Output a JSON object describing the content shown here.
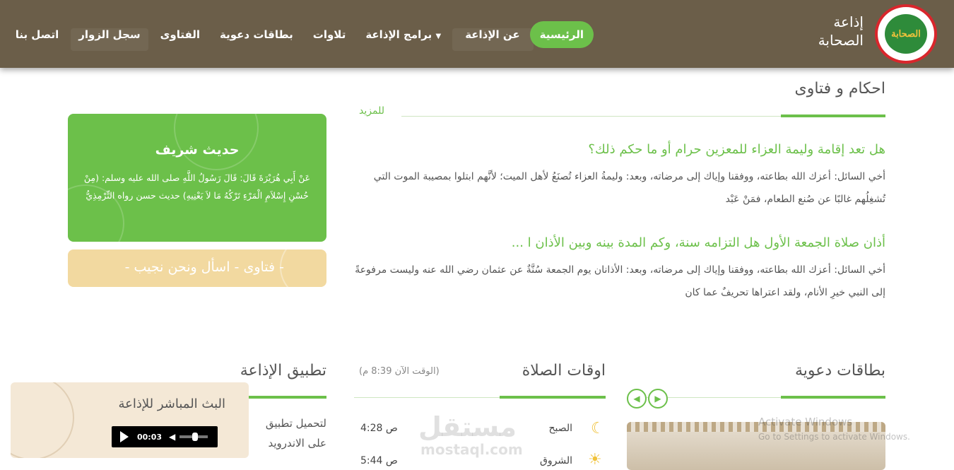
{
  "header": {
    "logo_label": "الصحابة",
    "site_name_line1": "إذاعة",
    "site_name_line2": "الصحابة",
    "nav": [
      {
        "label": "الرئيسية",
        "active": true
      },
      {
        "label": "عن الإذاعة"
      },
      {
        "label": "برامج الإذاعة",
        "has_dropdown": true
      },
      {
        "label": "تلاوات"
      },
      {
        "label": "بطاقات دعوية"
      },
      {
        "label": "الفتاوى"
      },
      {
        "label": "سجل الزوار"
      },
      {
        "label": "اتصل بنا"
      }
    ]
  },
  "fatwas": {
    "title": "احكام و فتاوى",
    "more": "للمزيد",
    "items": [
      {
        "title": "هل تعد إقامة وليمة العزاء للمعزين حرام أو ما حكم ذلك؟",
        "body": "أخي السائل: أعزك الله بطاعته، ووفقنا وإياك إلى مرضاته، وبعد: وليمةُ العزاء تُصنَعُ لأهل الميت؛ لأنَّهم ابتلوا بمصيبة الموت التي تُشغِلُهم غالبًا عن صُنع الطعام، فمَنْ عَبْد"
      },
      {
        "title": "أذان صلاة الجمعة الأول هل التزامه سنة، وكم المدة بينه وبين الأذان ا ...",
        "body": "أخي السائل: أعزك الله بطاعته، ووفقنا وإياك إلى مرضاته، وبعد: الأذانان يوم الجمعة سُنَّةٌ عن عثمان رضي الله عنه وليست مرفوعةً إلى النبي خيرِ الأنام، ولقد اعتراها تحريفٌ عما كان"
      }
    ]
  },
  "hadith": {
    "title": "حديث شريف",
    "body": "عَنْ أَبِي هُرَيْرَةَ قَالَ: قَالَ رَسُولُ اللَّهِ صلى الله عليه وسلم: (مِنْ حُسْنِ إِسْلاَمِ الْمَرْءِ تَرْكُهُ مَا لاَ يَعْنِيهِ) حديث حسن رواه التِّرْمِذِيُّ"
  },
  "fatwa_banner": "- فتاوى - اسأل ونحن نجيب -",
  "cards_section": {
    "title": "بطاقات دعوية"
  },
  "prayer": {
    "title": "اوقات الصلاة",
    "now": "(الوقت الآن 8:39 م)",
    "rows": [
      {
        "name": "الصبح",
        "time": "4:28 ص",
        "icon": "moon-icon"
      },
      {
        "name": "الشروق",
        "time": "5:44 ص",
        "icon": "sun-icon"
      }
    ]
  },
  "app_section": {
    "title": "تطبيق الإذاعة",
    "line1": "لتحميل تطبيق",
    "line2": "على الاندرويد"
  },
  "player": {
    "title": "البث المباشر للإذاعة",
    "time": "00:03"
  },
  "watermark": {
    "line1": "مستقل",
    "line2": "mostaql.com"
  },
  "os_overlay": {
    "line1": "Activate Windows",
    "line2": "Go to Settings to activate Windows."
  },
  "colors": {
    "header": "#6b5e49",
    "accent": "#6cc04a",
    "banner": "#f2d9a0"
  }
}
